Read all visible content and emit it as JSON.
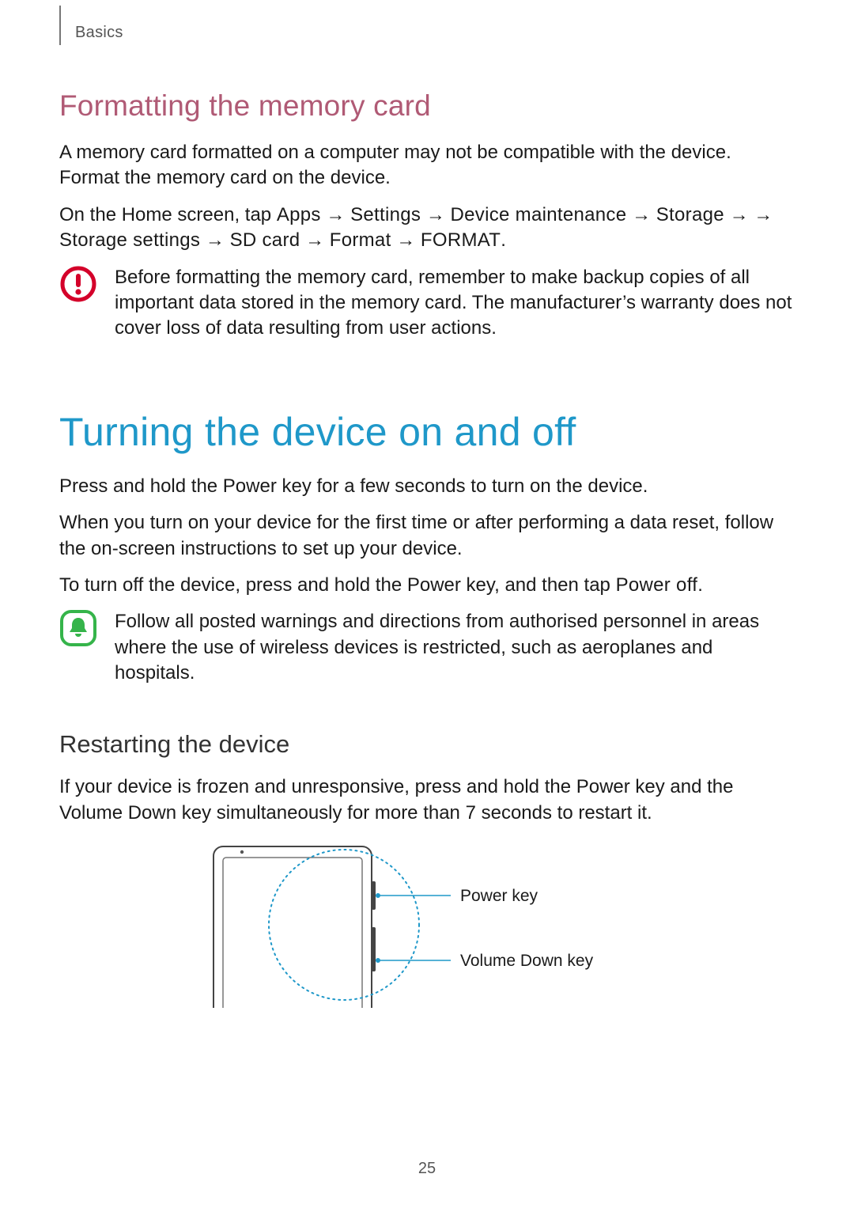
{
  "header": {
    "section": "Basics"
  },
  "h2_formatting": "Formatting the memory card",
  "p_formatting_intro": "A memory card formatted on a computer may not be compatible with the device. Format the memory card on the device.",
  "path_line": {
    "prefix": "On the Home screen, tap ",
    "seg1": "Apps",
    "seg2": "Settings",
    "seg3": "Device maintenance",
    "seg4": "Storage",
    "seg5": "",
    "seg6": "Storage settings",
    "seg7": "SD card",
    "seg8": "Format",
    "seg9": "FORMAT",
    "arrow": "→"
  },
  "callout_caution": "Before formatting the memory card, remember to make backup copies of all important data stored in the memory card. The manufacturer’s warranty does not cover loss of data resulting from user actions.",
  "h1_power": "Turning the device on and off",
  "p_power_1": "Press and hold the Power key for a few seconds to turn on the device.",
  "p_power_2": "When you turn on your device for the first time or after performing a data reset, follow the on-screen instructions to set up your device.",
  "p_power_3_pre": "To turn off the device, press and hold the Power key, and then tap ",
  "p_power_3_ui": "Power off",
  "p_power_3_post": ".",
  "callout_note": "Follow all posted warnings and directions from authorised personnel in areas where the use of wireless devices is restricted, such as aeroplanes and hospitals.",
  "h3_restart": "Restarting the device",
  "p_restart": "If your device is frozen and unresponsive, press and hold the Power key and the Volume Down key simultaneously for more than 7 seconds to restart it.",
  "diagram": {
    "label_power": "Power key",
    "label_voldown": "Volume Down key"
  },
  "page_number": "25"
}
